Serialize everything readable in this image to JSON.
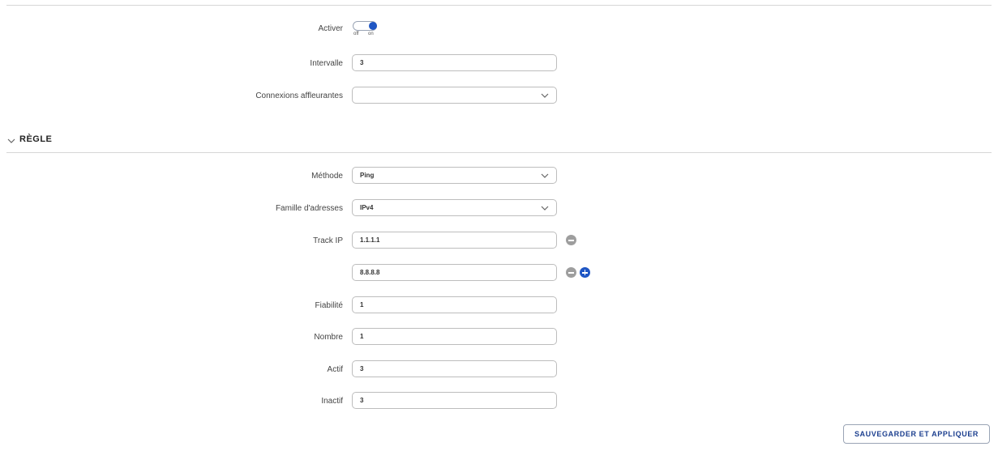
{
  "general": {
    "enable": {
      "label": "Activer",
      "state": "on",
      "off_label": "off",
      "on_label": "on"
    },
    "interval": {
      "label": "Intervalle",
      "value": "3"
    },
    "flush_connections": {
      "label": "Connexions affleurantes",
      "value": ""
    }
  },
  "rule_section": {
    "title": "RÈGLE",
    "method": {
      "label": "Méthode",
      "value": "Ping"
    },
    "address_family": {
      "label": "Famille d'adresses",
      "value": "IPv4"
    },
    "track_ip": {
      "label": "Track IP",
      "values": [
        "1.1.1.1",
        "8.8.8.8"
      ]
    },
    "reliability": {
      "label": "Fiabilité",
      "value": "1"
    },
    "count": {
      "label": "Nombre",
      "value": "1"
    },
    "up": {
      "label": "Actif",
      "value": "3"
    },
    "down": {
      "label": "Inactif",
      "value": "3"
    }
  },
  "footer": {
    "save_apply_label": "SAUVEGARDER ET APPLIQUER"
  },
  "colors": {
    "accent": "#1f56c4",
    "border": "#bdbdbd",
    "muted_button": "#9e9e9e"
  }
}
